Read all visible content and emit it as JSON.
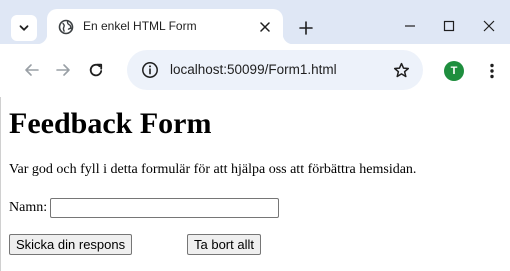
{
  "browser": {
    "tab": {
      "title": "En enkel HTML Form"
    },
    "address_bar": {
      "url": "localhost:50099/Form1.html"
    },
    "profile": {
      "initial": "T",
      "color": "#1e8e3e"
    },
    "icons": {
      "tab_search": "chevron-down-icon",
      "favicon": "globe-icon",
      "tab_close": "close-icon",
      "new_tab": "plus-icon",
      "minimize": "minimize-icon",
      "maximize": "maximize-icon",
      "close_window": "close-icon",
      "back": "arrow-left-icon",
      "forward": "arrow-right-icon",
      "reload": "reload-icon",
      "site_info": "info-icon",
      "bookmark": "star-icon",
      "menu": "more-vert-icon"
    },
    "colors": {
      "frame": "#dfe7f5",
      "omnibox": "#edf2fa"
    }
  },
  "page": {
    "title": "Feedback Form",
    "intro": "Var god och fyll i detta formulär för att hjälpa oss att förbättra hemsidan.",
    "form": {
      "name_label": "Namn:",
      "name_value": "",
      "submit_label": "Skicka din respons",
      "reset_label": "Ta bort allt"
    }
  }
}
